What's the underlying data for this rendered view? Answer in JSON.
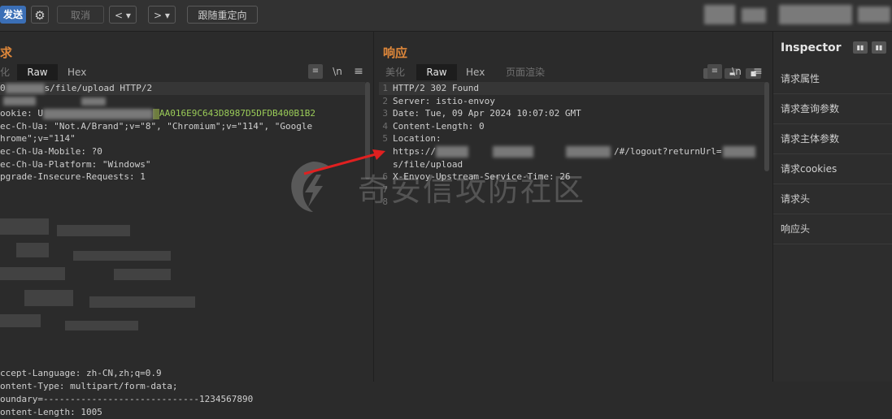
{
  "toolbar": {
    "send_label": "发送",
    "cancel_label": "取消",
    "prev_label": "< ▾",
    "next_label": "> ▾",
    "follow_redirect_label": "跟随重定向"
  },
  "request": {
    "title": "求",
    "tabs": [
      "化",
      "Raw",
      "Hex"
    ],
    "active_tab": "Raw",
    "newline_icon": "\\n",
    "menu_icon": "≡",
    "lines": [
      {
        "pre": "0",
        "text": "s/file/upload ",
        "post": "HTTP/2"
      },
      {
        "pre": "",
        "text": "",
        "post": ""
      },
      {
        "pre": "ookie: U",
        "text": "",
        "post": "AA016E9C643D8987D5DFDB400B1B2"
      },
      {
        "pre": "ec-Ch-Ua: ",
        "text": "\"Not.A/Brand\";v=\"8\", \"Chromium\";v=\"114\", \"Google",
        "post": ""
      },
      {
        "pre": "hrome\";v=\"114\"",
        "text": "",
        "post": ""
      },
      {
        "pre": "ec-Ch-Ua-Mobile: ",
        "text": "?0",
        "post": ""
      },
      {
        "pre": "ec-Ch-Ua-Platform: ",
        "text": "\"Windows\"",
        "post": ""
      },
      {
        "pre": "pgrade-Insecure-Requests: ",
        "text": "1",
        "post": ""
      }
    ],
    "bottom_lines": [
      "ccept-Language: zh-CN,zh;q=0.9",
      "ontent-Type: multipart/form-data;",
      "oundary=-----------------------------1234567890",
      "ontent-Length: 1005"
    ]
  },
  "response": {
    "title": "响应",
    "tabs": [
      "美化",
      "Raw",
      "Hex",
      "页面渲染"
    ],
    "active_tab": "Raw",
    "newline_icon": "\\n",
    "menu_icon": "≡",
    "lines": [
      {
        "num": "1",
        "text": "HTTP/2 302 Found"
      },
      {
        "num": "2",
        "text": "Server: istio-envoy"
      },
      {
        "num": "3",
        "text": "Date: Tue, 09 Apr 2024 10:07:02 GMT"
      },
      {
        "num": "4",
        "text": "Content-Length: 0"
      },
      {
        "num": "5",
        "text": "Location:"
      },
      {
        "num": "",
        "text": "https://"
      },
      {
        "num": "",
        "text": "s/file/upload"
      },
      {
        "num": "6",
        "text": "X-Envoy-Upstream-Service-Time: 26"
      },
      {
        "num": "7",
        "text": ""
      },
      {
        "num": "8",
        "text": ""
      }
    ],
    "location_tail": "/#/logout?returnUrl="
  },
  "inspector": {
    "title": "Inspector",
    "items": [
      "请求属性",
      "请求查询参数",
      "请求主体参数",
      "请求cookies",
      "请求头",
      "响应头"
    ]
  },
  "watermark": {
    "text": "奇安信攻防社区"
  },
  "colors": {
    "accent": "#e0883a",
    "send_bg": "#3b6fb6",
    "arrow": "#e02020"
  }
}
